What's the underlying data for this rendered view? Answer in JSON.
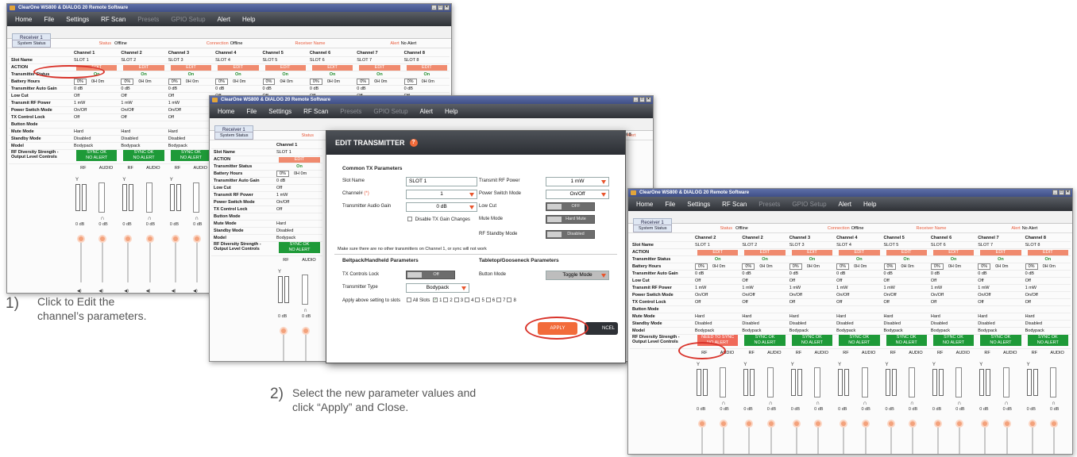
{
  "window": {
    "title": "ClearOne WS800 & DIALOG 20 Remote Software",
    "controls": [
      "_",
      "□",
      "×"
    ]
  },
  "menu": {
    "home": "Home",
    "file": "File",
    "settings": "Settings",
    "rf_scan": "RF Scan",
    "presets": "Presets",
    "gpio": "GPIO Setup",
    "alert": "Alert",
    "help": "Help"
  },
  "tab": "Receiver 1",
  "status": {
    "system_status": "System Status",
    "status_label": "Status",
    "status_value": "Offline",
    "connection_label": "Connection",
    "connection_value": "Offline",
    "receiver_name": "Receiver Name",
    "alert_label": "Alert",
    "alert_value": "No Alert"
  },
  "labels": {
    "slot_name": "Slot Name",
    "action": "ACTION",
    "tx_status": "Transmitter Status",
    "battery": "Battery Hours",
    "auto_gain": "Transmitter Auto Gain",
    "low_cut": "Low Cut",
    "rf_power": "Transmit RF Power",
    "power_switch": "Power Switch Mode",
    "tx_lock": "TX Control Lock",
    "button_mode": "Button Mode",
    "mute_mode": "Mute Mode",
    "standby_mode": "Standby Mode",
    "model": "Model",
    "rf_diversity_1": "RF Diversity Strength -",
    "rf_diversity_2": "Output Level Controls"
  },
  "cell_values": {
    "edit": "EDIT",
    "on": "On",
    "batt_pct": "0%",
    "batt_time": "0H 0m",
    "gain": "0 dB",
    "off": "Off",
    "rf_power": "1 mW",
    "power_switch": "On/Off",
    "mute": "Hard",
    "standby": "Disabled",
    "model": "Bodypack",
    "sync_ok": "SYNC OK",
    "no_alert": "NO ALERT",
    "need_to_sync": "NEED TO SYNC",
    "rf": "RF",
    "audio": "AUDIO",
    "meter_db": "0 dB"
  },
  "win1": {
    "channels": [
      "Channel 1",
      "Channel 2",
      "Channel 3",
      "Channel 4",
      "Channel 5",
      "Channel 6",
      "Channel 7",
      "Channel 8"
    ],
    "slots": [
      "SLOT 1",
      "SLOT 2",
      "SLOT 3",
      "SLOT 4",
      "SLOT 5",
      "SLOT 6",
      "SLOT 7",
      "SLOT 8"
    ]
  },
  "win2": {
    "channels": [
      "Channel 1"
    ],
    "slots": [
      "SLOT 1"
    ],
    "alert_partial": "Alert",
    "alert_value": "el 8"
  },
  "win3": {
    "channels": [
      "Channel 2",
      "Channel 2",
      "Channel 3",
      "Channel 4",
      "Channel 5",
      "Channel 6",
      "Channel 7",
      "Channel 8"
    ],
    "slots": [
      "SLOT 1",
      "SLOT 2",
      "SLOT 3",
      "SLOT 4",
      "SLOT 5",
      "SLOT 6",
      "SLOT 7",
      "SLOT 8"
    ]
  },
  "dialog": {
    "title": "EDIT TRANSMITTER",
    "help_glyph": "?",
    "common_header": "Common TX Parameters",
    "slot_name_label": "Slot Name",
    "slot_name_value": "SLOT 1",
    "channel_label": "Channel#",
    "channel_marker": "(*)",
    "channel_value": "1",
    "audio_gain_label": "Transmitter Audio Gain",
    "audio_gain_value": "0 dB",
    "disable_tx_gain": "Disable TX Gain Changes",
    "rf_power_label": "Transmit RF Power",
    "rf_power_value": "1 mW",
    "power_switch_label": "Power Switch Mode",
    "power_switch_value": "On/Off",
    "low_cut_label": "Low Cut",
    "low_cut_value": "OFF",
    "mute_label": "Mute Mode",
    "mute_value": "Hard Mute",
    "standby_label": "RF Standby Mode",
    "standby_value": "Disabled",
    "warning": "Make sure there are no other transmitters on Channel 1, or sync will not work",
    "beltpack_header": "Beltpack/Handheld Parameters",
    "tabletop_header": "Tabletop/Gooseneck Parameters",
    "tx_lock_label": "TX Controls Lock",
    "tx_lock_value": "Off",
    "tx_type_label": "Transmitter Type",
    "tx_type_value": "Bodypack",
    "button_mode_label": "Button Mode",
    "button_mode_value": "Toggle Mode",
    "apply_slots_label": "Apply above setting to slots",
    "all_slots": "All Slots",
    "slot_numbers": [
      "1",
      "2",
      "3",
      "4",
      "5",
      "6",
      "7",
      "8"
    ],
    "apply": "APPLY",
    "cancel": "NCEL"
  },
  "captions": {
    "step1_num": "1)",
    "step1_line1": "Click to Edit the",
    "step1_line2": "channel’s parameters.",
    "step2_num": "2)",
    "step2_line1": "Select the new parameter values and",
    "step2_line2": "click “Apply” and Close."
  },
  "colors": {
    "accent_orange": "#f08a6e",
    "sync_green": "#1e9a38",
    "need_sync_red": "#f06a5a",
    "highlight_circle": "#d9342b"
  }
}
